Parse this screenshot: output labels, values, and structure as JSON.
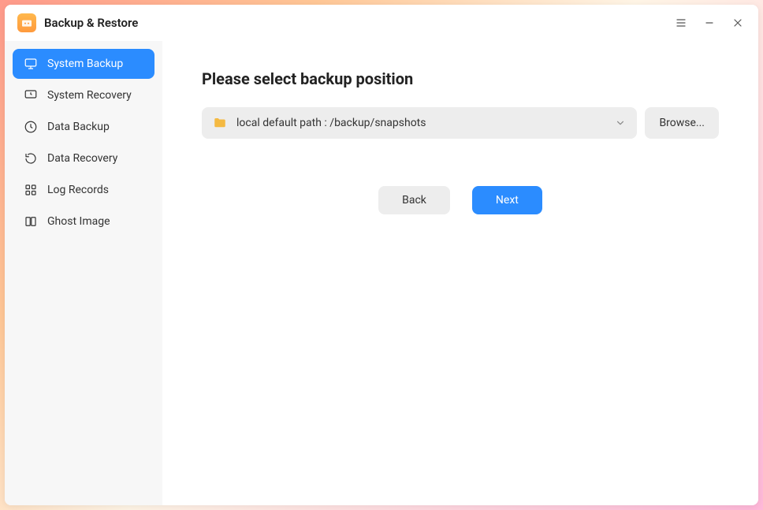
{
  "app": {
    "title": "Backup & Restore"
  },
  "sidebar": {
    "items": [
      {
        "label": "System Backup",
        "active": true
      },
      {
        "label": "System Recovery",
        "active": false
      },
      {
        "label": "Data Backup",
        "active": false
      },
      {
        "label": "Data Recovery",
        "active": false
      },
      {
        "label": "Log Records",
        "active": false
      },
      {
        "label": "Ghost Image",
        "active": false
      }
    ]
  },
  "main": {
    "heading": "Please select backup position",
    "path_value": "local default path : /backup/snapshots",
    "browse_label": "Browse...",
    "back_label": "Back",
    "next_label": "Next"
  }
}
